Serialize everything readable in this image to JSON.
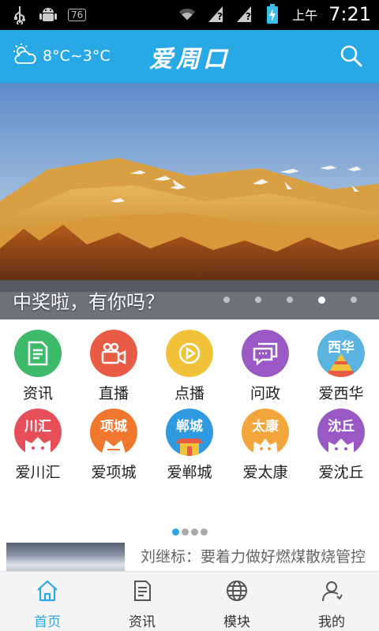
{
  "status_bar": {
    "badge": "76",
    "ampm": "上午",
    "time": "7:21"
  },
  "header": {
    "weather": "8°C~3°C",
    "title": "爱周口"
  },
  "banner": {
    "caption": "中奖啦，有你吗？",
    "page_count": 5,
    "active_index": 3
  },
  "grid": {
    "items": [
      {
        "label": "资讯",
        "color": "#3dbb6a",
        "icon": "news-icon"
      },
      {
        "label": "直播",
        "color": "#e85c45",
        "icon": "video-camera-icon"
      },
      {
        "label": "点播",
        "color": "#f2c23a",
        "icon": "play-icon"
      },
      {
        "label": "问政",
        "color": "#9a58c4",
        "icon": "chat-icon"
      },
      {
        "label": "爱西华",
        "color": "#5bb3e0",
        "city": "西华"
      },
      {
        "label": "爱川汇",
        "color": "#e64e5a",
        "city": "川汇"
      },
      {
        "label": "爱项城",
        "color": "#f0782e",
        "city": "项城"
      },
      {
        "label": "爱郸城",
        "color": "#2f9ae0",
        "city": "郸城"
      },
      {
        "label": "爱太康",
        "color": "#f2a53a",
        "city": "太康"
      },
      {
        "label": "爱沈丘",
        "color": "#9a58c4",
        "city": "沈丘"
      }
    ]
  },
  "news": {
    "title": "刘继标：要着力做好燃煤散烧管控工作"
  },
  "tabbar": {
    "tabs": [
      {
        "label": "首页",
        "icon": "home-icon"
      },
      {
        "label": "资讯",
        "icon": "document-icon"
      },
      {
        "label": "模块",
        "icon": "globe-icon"
      },
      {
        "label": "我的",
        "icon": "user-icon"
      }
    ],
    "active_index": 0
  },
  "colors": {
    "accent": "#29a8e6"
  }
}
